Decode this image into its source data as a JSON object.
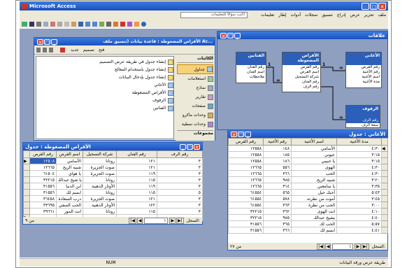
{
  "app": {
    "title": "Microsoft Access",
    "ask_placeholder": "اكتب سؤالاً للتعليمات",
    "menu": [
      "ملف",
      "تحرير",
      "عرض",
      "إدراج",
      "تنسيق",
      "سجلات",
      "أدوات",
      "إطار",
      "تعليمات"
    ],
    "status_left": "طريقة عرض ورقة البيانات",
    "status_num": "NUM"
  },
  "db_window": {
    "title": "الأفراص المضغوطة : قاعدة بيانات (تنسيق ملف Ac...",
    "toolbar_open": "فتح",
    "toolbar_design": "تصميم",
    "toolbar_new": "جديد",
    "objects_header": "الكائنات",
    "objects": [
      "جداول",
      "استعلامات",
      "نماذج",
      "تقارير",
      "صفحات",
      "وحدات ماكرو",
      "وحدات نمطية"
    ],
    "groups_header": "مجموعات",
    "items": [
      "إنشاء جدول في طريقة عرض التصميم",
      "إنشاء جدول باستخدام المعالج",
      "إنشاء جدول بإدخال البيانات",
      "الأغاني",
      "الأفراص المضغوطة",
      "الرفوف",
      "الفنانين"
    ]
  },
  "relations_window": {
    "title": "علاقات",
    "tables": [
      {
        "name": "الفنانين",
        "fields": [
          "رقم الفنان",
          "اسم الفنان",
          "ملاحظات"
        ]
      },
      {
        "name": "الأقراص المضغوطة",
        "fields": [
          "رقم القرص",
          "اسم القرص",
          "شركة التسجيل",
          "رقم الفنان",
          "رقم الرف"
        ]
      },
      {
        "name": "الأغاني",
        "fields": [
          "رقم القرص",
          "رقم الأغنية",
          "اسم الأغنية",
          "مدة الأغنية"
        ]
      },
      {
        "name": "الرفوف",
        "fields": [
          "رقم الرف",
          "سعة الرف"
        ]
      }
    ],
    "rel_labels": [
      "1",
      "∞",
      "1",
      "∞",
      "∞"
    ]
  },
  "discs_table": {
    "title": "الأقراص المضغوطة : جدول",
    "columns": [
      "رقم الرف",
      "رقم الفنان",
      "شركة التسجيل",
      "اسم القرص",
      "رقم القرص"
    ],
    "rows": [
      [
        "٣",
        "١٢١",
        "روتانا",
        "الأسامي",
        "١٢٥٠٨"
      ],
      [
        "٣",
        "١٢١",
        "صوت الجزيرة",
        "شبيه الريح",
        "١٢٦٦٥"
      ],
      [
        "٣",
        "١١٩",
        "صوت الجزيرة",
        "يا هواي",
        "٦١٥٠٤"
      ],
      [
        "٣",
        "١١٥",
        "روتانا",
        "يا شيخ عبداللـ",
        "٣٢٢١٥"
      ],
      [
        "٣",
        "١١٩",
        "الأوتار الذهبية",
        "ابن الدنيا",
        "٣١٥٥٦"
      ],
      [
        "٥",
        "١١٥",
        "روتانا",
        "ابسم لك",
        "٣١٥٥٦"
      ],
      [
        "٣",
        "١٢١",
        "صوت الجزيرة",
        "درب السعادة",
        "٣٦٤٥٨"
      ],
      [
        "٣",
        "١٢٢",
        "الأوتار الذهبية",
        "الحب المنفي",
        "٣٣٦٩٥"
      ],
      [
        "٣",
        "١١٥",
        "روتانا",
        "انت الموز",
        "٣٩٦٦١"
      ]
    ],
    "nav_label": "السجل:",
    "nav_current": "١",
    "nav_total": "من ٩"
  },
  "songs_table": {
    "title": "الأغاني : جدول",
    "columns": [
      "مدة الأغنية",
      "اسم الأغنية",
      "رقم الأغنية",
      "رقم القرص"
    ],
    "rows": [
      [
        "٤:٣٠",
        "الأسامي",
        "١٤٨",
        "١٢٥٥٨"
      ],
      [
        "٣:١٥",
        "عيوني",
        "١٨٥",
        "١٢٥٥٨"
      ],
      [
        "٣:١٥",
        "يا حبيبي",
        "١٨٦",
        "١٢٥٥٨"
      ],
      [
        "٤:٣٠",
        "الهوى",
        "٥٥٦",
        "١٢٦٦٥"
      ],
      [
        "٤:٣٠",
        "الحب",
        "٣٦٦",
        "١٢٦٦٥"
      ],
      [
        "٣:٢٠",
        "شبيه الريح",
        "٩٨٥",
        "١٢٦٦٥"
      ],
      [
        "٣:٣٥",
        "يا سامعني",
        "٣١٤",
        "١٢٦٦٥"
      ],
      [
        "٥:٤٣",
        "أحبك حيل",
        "٥٦٥",
        "٦١٥٥٤"
      ],
      [
        "٣:٤٥",
        "أموت من نظرته",
        "٥٧٨",
        "٦١٥٥٤"
      ],
      [
        "٣:٠٠",
        "الحب من نظرة",
        "٣٦٣",
        "٦١٥٥٤"
      ],
      [
        "٤:١٠",
        "انت الهوى",
        "٣٦٢",
        "٣٢٢١٥"
      ],
      [
        "٤:٤٠",
        "يشيخ عبداللـ",
        "٩٨٥",
        "٣٢٢١٥"
      ],
      [
        "٥:٥٧",
        "الحب لك",
        "٣٦٥",
        "٣١٥٥٦"
      ],
      [
        "٤:٤١",
        "ابسم لك",
        "٣٦٦",
        "٣١٥٥٦"
      ]
    ],
    "nav_label": "السجل:",
    "nav_current": "١",
    "nav_total": "من ٢٧"
  }
}
